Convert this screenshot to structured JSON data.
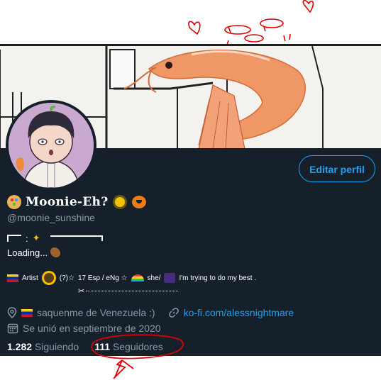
{
  "header": {
    "edit_profile_label": "Editar perfil"
  },
  "profile": {
    "display_name": "Moonie-Eh?",
    "handle": "@moonie_sunshine",
    "bio_line1": ":",
    "bio_line2": "Loading...",
    "bio_line3": {
      "artist": "Artist",
      "pronoun": "(?)☆",
      "langs": "17 Esp / eNg ☆",
      "she": "she/",
      "trying": "I'm trying to do my best ."
    },
    "bio_line4_scissors": "✂"
  },
  "meta": {
    "location": "saquenme de Venezuela :)",
    "website": "ko-fi.com/alessnightmare",
    "joined": "Se unió en septiembre de 2020"
  },
  "stats": {
    "following_count": "1.282",
    "following_label": "Siguiendo",
    "followers_count": "111",
    "followers_label": "Seguidores"
  },
  "colors": {
    "background": "#15202b",
    "accent": "#1da1f2",
    "muted": "#8899a6",
    "annotation_red": "#e00000"
  },
  "icons": {
    "location": "location-pin-icon",
    "link": "link-icon",
    "calendar": "calendar-icon"
  }
}
